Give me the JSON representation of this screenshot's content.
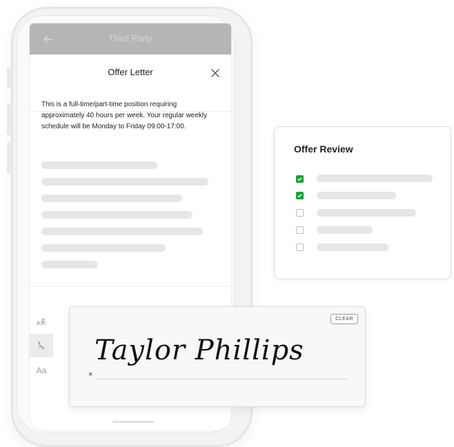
{
  "phone": {
    "topbar_title": "Third Party",
    "header_title": "Offer Letter",
    "body_text": "This is a full-time/part-time position requiring approximately 40 hours per week. Your regular weekly schedule will be Monday to Friday 09:00-17:00.",
    "tools": [
      {
        "icon": "signature-pen-icon"
      },
      {
        "icon": "draw-icon"
      },
      {
        "icon": "type-text-icon",
        "label": "Aa"
      }
    ]
  },
  "review": {
    "title": "Offer Review",
    "items": [
      {
        "checked": true
      },
      {
        "checked": true
      },
      {
        "checked": false
      },
      {
        "checked": false
      },
      {
        "checked": false
      }
    ]
  },
  "signature": {
    "clear_label": "CLEAR",
    "x_mark": "×",
    "signed_name": "Taylor Phillips"
  },
  "colors": {
    "check_green": "#1f9d3a",
    "topbar_gray": "#b5b5b5",
    "placeholder_gray": "#e6e6e6"
  }
}
